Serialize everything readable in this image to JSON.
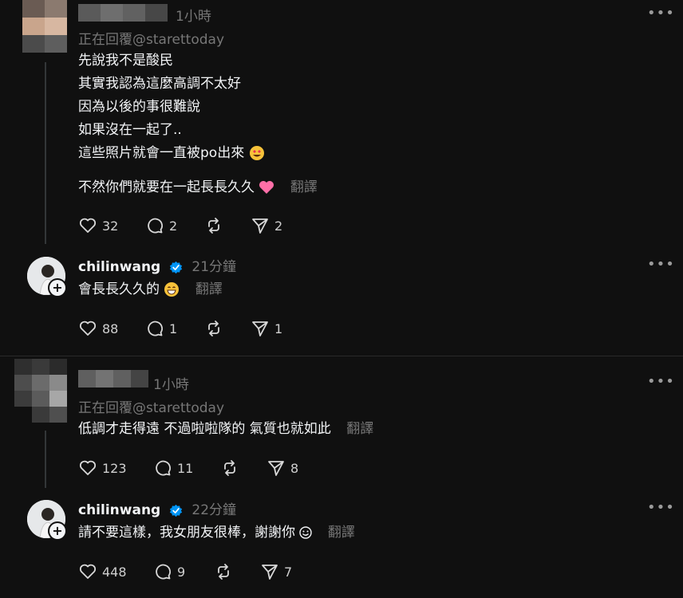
{
  "comments": [
    {
      "time": "1小時",
      "reply_to": "正在回覆@starettoday",
      "lines": [
        "先說我不是酸民",
        "其實我認為這麼高調不太好",
        "因為以後的事很難說",
        "如果沒在一起了..",
        "這些照片就會一直被po出來"
      ],
      "last_line": "不然你們就要在一起長長久久",
      "translate": "翻譯",
      "likes": "32",
      "replies": "2",
      "shares": "2"
    },
    {
      "username": "chilinwang",
      "time": "21分鐘",
      "text": "會長長久久的",
      "translate": "翻譯",
      "likes": "88",
      "replies": "1",
      "shares": "1"
    },
    {
      "time": "1小時",
      "reply_to": "正在回覆@starettoday",
      "text": "低調才走得遠 不過啦啦隊的 氣質也就如此",
      "translate": "翻譯",
      "likes": "123",
      "replies": "11",
      "shares": "8"
    },
    {
      "username": "chilinwang",
      "time": "22分鐘",
      "text": "請不要這樣，我女朋友很棒，謝謝你",
      "translate": "翻譯",
      "likes": "448",
      "replies": "9",
      "shares": "7"
    }
  ],
  "more_label": "•••",
  "colors": {
    "background": "#101010",
    "text": "#f3f5f7",
    "muted": "#777777",
    "verified": "#0095f6",
    "heart": "#ff6fa8"
  },
  "icons": [
    "heart-icon",
    "comment-icon",
    "repost-icon",
    "share-icon",
    "more-icon",
    "verified-icon",
    "follow-plus-icon",
    "smiling-face-with-heart-eyes-emoji",
    "pink-heart-emoji",
    "grinning-face-emoji",
    "smiling-face-emoji"
  ]
}
